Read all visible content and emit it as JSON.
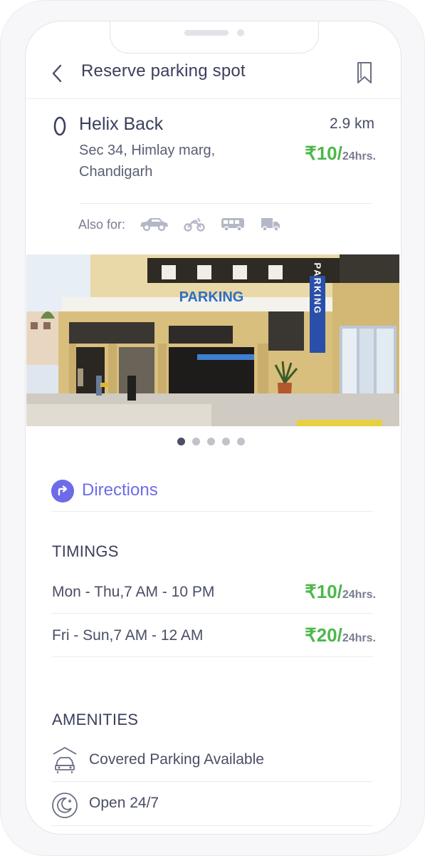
{
  "header": {
    "title": "Reserve parking spot"
  },
  "location": {
    "name": "Helix Back",
    "distance": "2.9 km",
    "address_line1": "Sec 34, Himlay marg,",
    "address_line2": "Chandigarh",
    "price": "₹10/",
    "price_unit": "24hrs."
  },
  "also_for": {
    "label": "Also for:",
    "vehicles": [
      "car-icon",
      "bike-icon",
      "bus-icon",
      "truck-icon"
    ]
  },
  "photo": {
    "sign_text": "PARKING",
    "vertical_sign_text": "PARKING"
  },
  "carousel": {
    "count": 5,
    "active_index": 0
  },
  "directions": {
    "label": "Directions"
  },
  "timings": {
    "title": "TIMINGS",
    "rows": [
      {
        "label": "Mon - Thu,7 AM - 10 PM",
        "price": "₹10/",
        "unit": "24hrs."
      },
      {
        "label": "Fri - Sun,7 AM - 12 AM",
        "price": "₹20/",
        "unit": "24hrs."
      }
    ]
  },
  "amenities": {
    "title": "AMENITIES",
    "items": [
      {
        "label": "Covered Parking Available",
        "icon": "covered-parking-icon"
      },
      {
        "label": "Open 24/7",
        "icon": "open-24-7-icon"
      }
    ]
  },
  "colors": {
    "accent": "#6e6be8",
    "price_green": "#4cb84a",
    "text_dark": "#3b3f5c"
  }
}
